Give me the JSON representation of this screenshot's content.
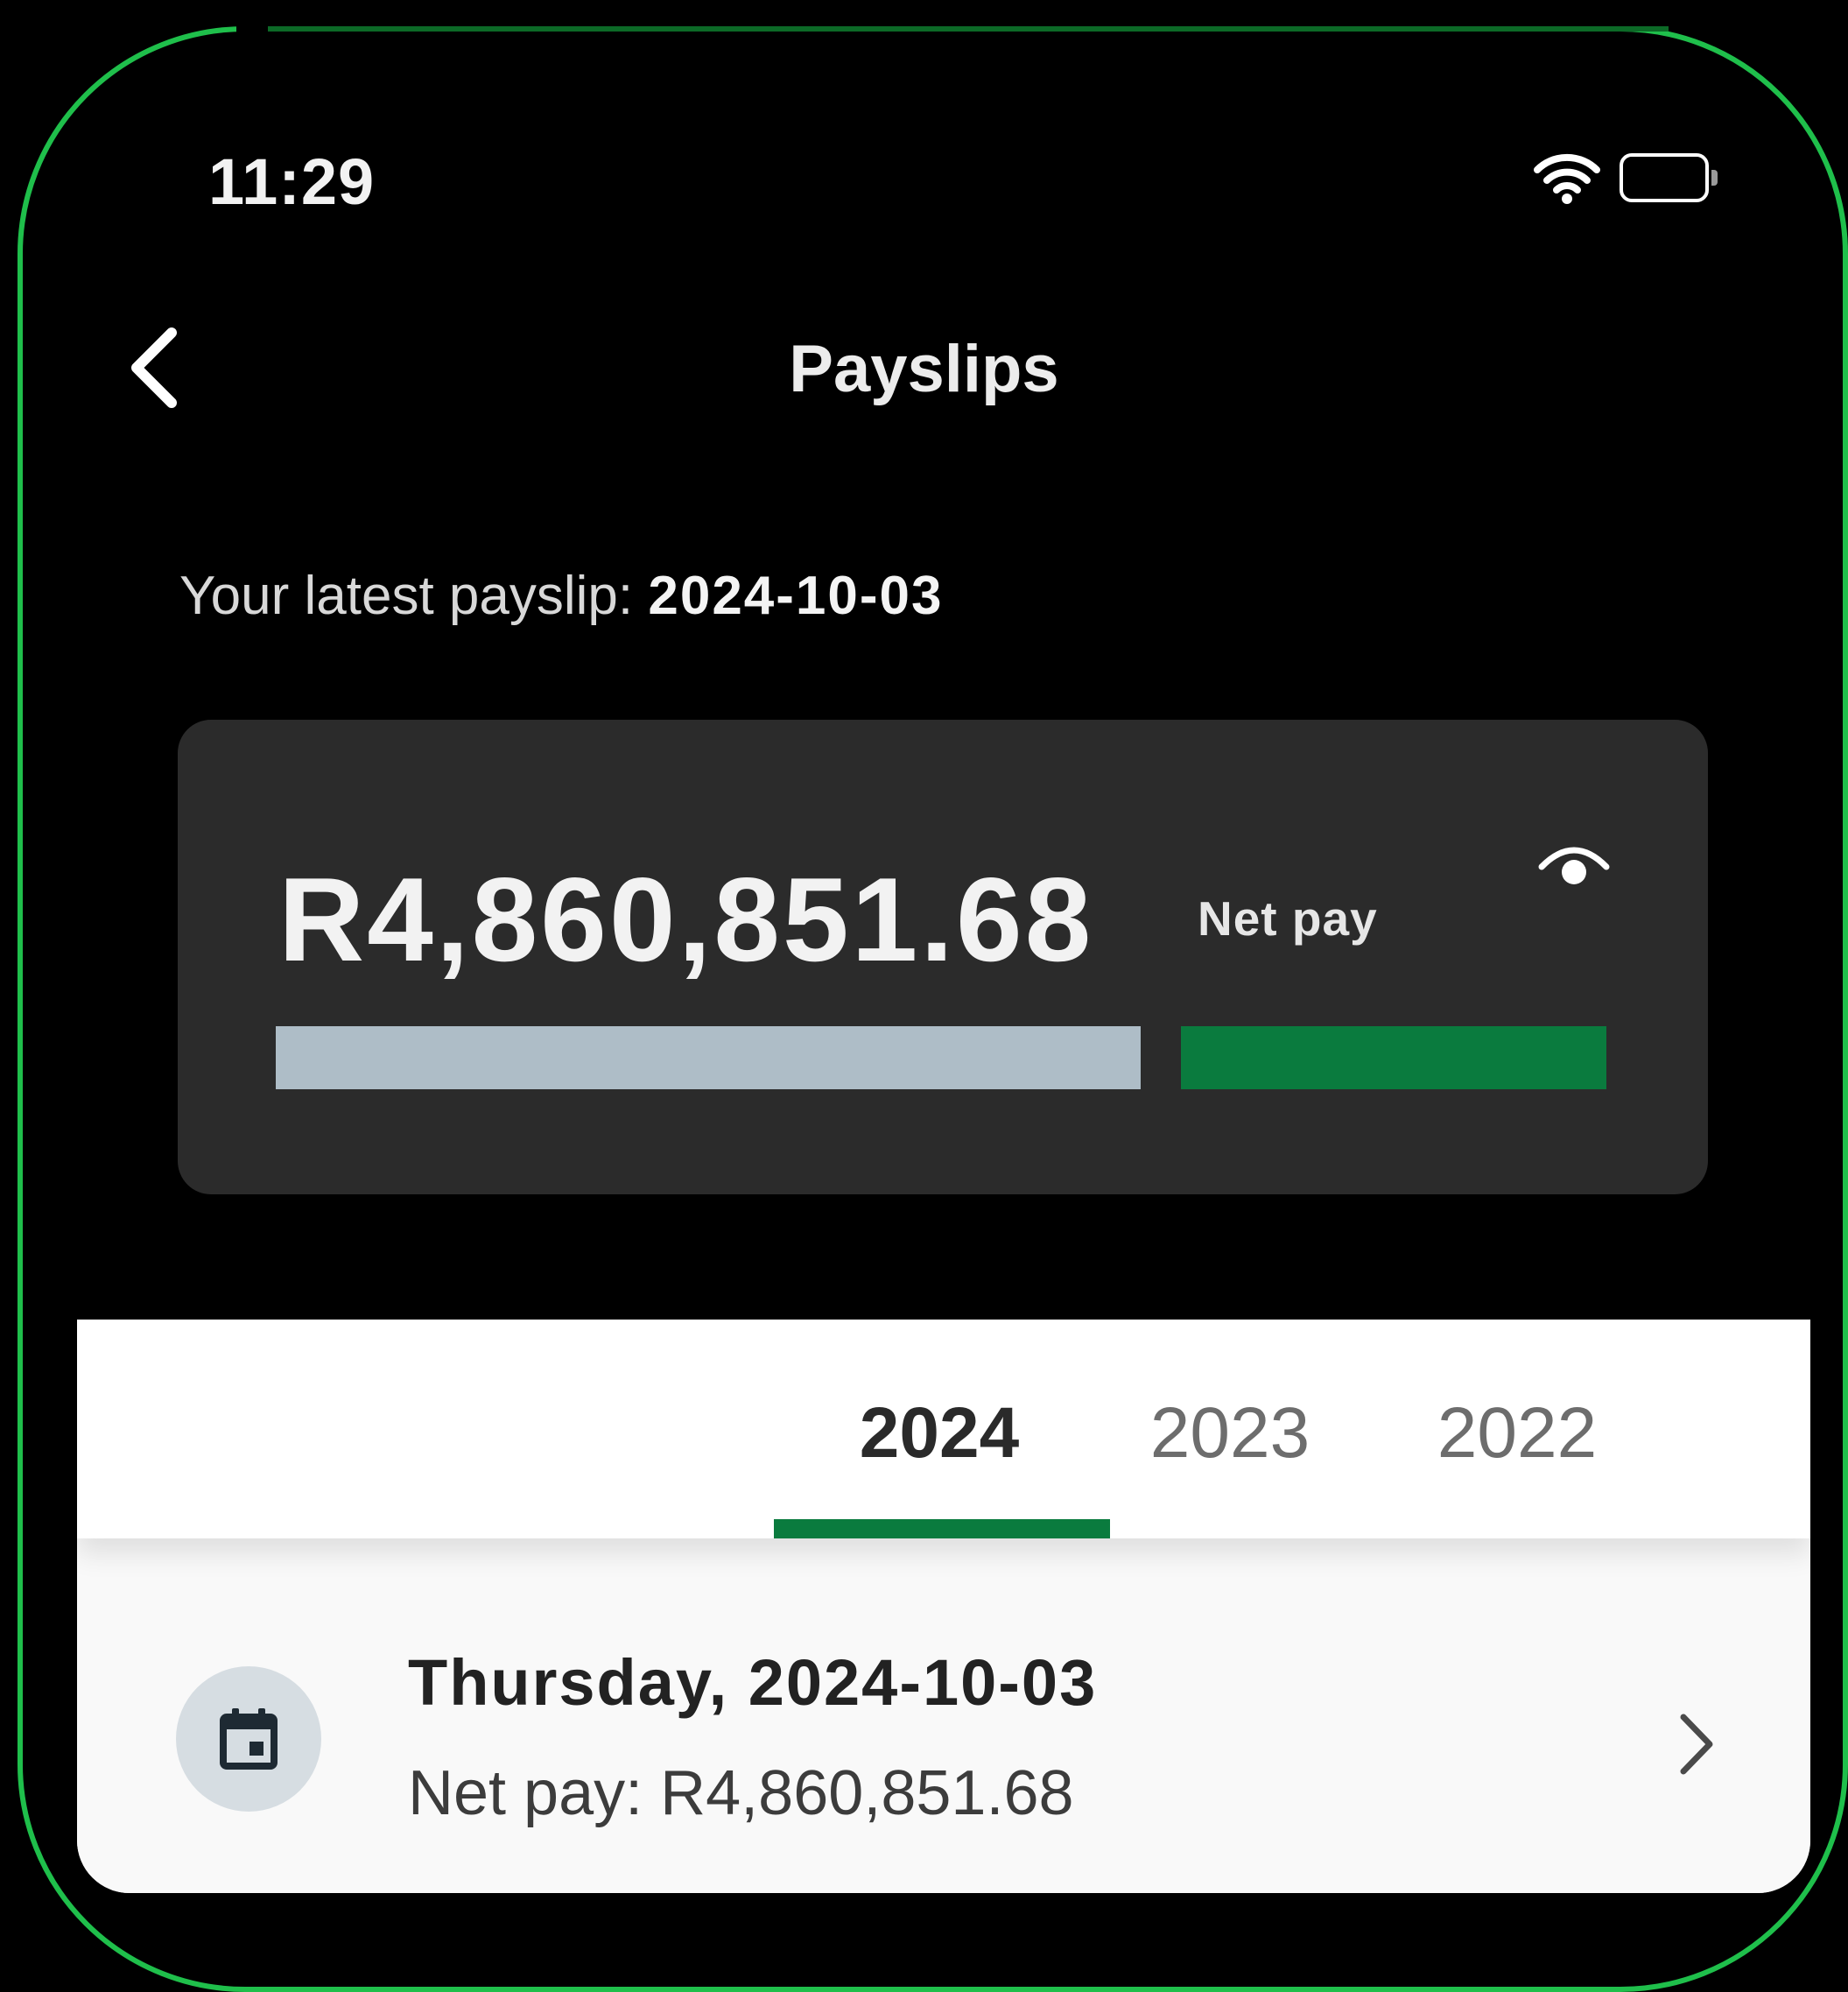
{
  "status_bar": {
    "time": "11:29",
    "icons": [
      "wifi-icon",
      "battery-icon"
    ]
  },
  "header": {
    "back_icon": "chevron-left-icon",
    "title": "Payslips"
  },
  "latest": {
    "label": "Your latest payslip: ",
    "date": "2024-10-03"
  },
  "summary": {
    "amount": "R4,860,851.68",
    "amount_label": "Net pay",
    "visibility_icon": "eye-icon",
    "net_pay_fraction": 0.33,
    "colors": {
      "deductions_bar": "#aebdc7",
      "net_pay_bar": "#0a7b3e"
    }
  },
  "tabs": {
    "items": [
      {
        "label": "2024",
        "active": true
      },
      {
        "label": "2023",
        "active": false
      },
      {
        "label": "2022",
        "active": false
      }
    ],
    "indicator_color": "#0a7b3e"
  },
  "payslips": [
    {
      "icon": "calendar-icon",
      "title": "Thursday, 2024-10-03",
      "subtitle": "Net pay: R4,860,851.68",
      "chevron": "chevron-right-icon"
    }
  ],
  "colors": {
    "accent": "#0a7b3e",
    "frame": "#1fbf4b",
    "background": "#000000",
    "card": "#2b2b2b"
  }
}
